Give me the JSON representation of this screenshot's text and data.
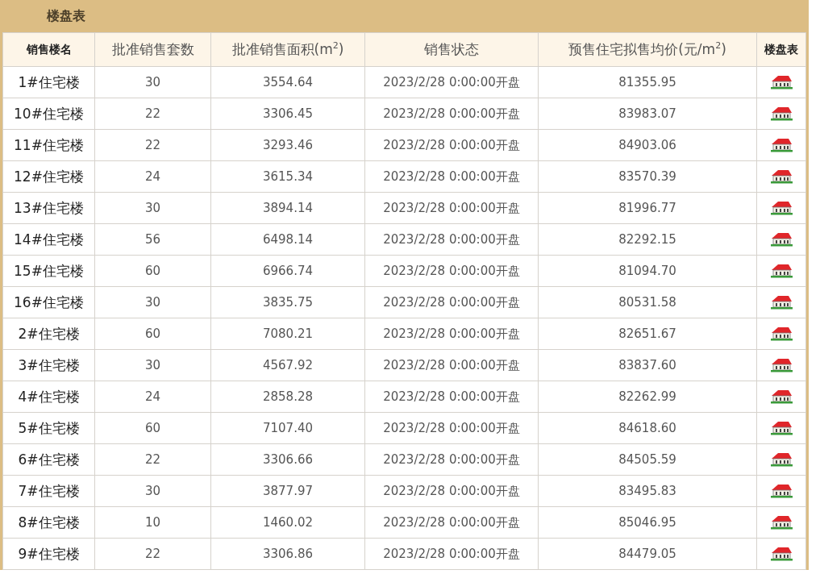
{
  "panel": {
    "title": "楼盘表"
  },
  "table": {
    "columns": [
      {
        "label": "销售楼名",
        "kind": "bold"
      },
      {
        "label": "批准销售套数",
        "kind": "plain"
      },
      {
        "label": "批准销售面积(m$^{2}$)",
        "kind": "plain"
      },
      {
        "label": "销售状态",
        "kind": "plain"
      },
      {
        "label": "预售住宅拟售均价(元/m$^{2}$)",
        "kind": "plain"
      },
      {
        "label": "楼盘表",
        "kind": "bold"
      }
    ],
    "rows": [
      [
        "1#住宅楼",
        "30",
        "3554.64",
        "2023/2/28 0:00:00开盘",
        "81355.95"
      ],
      [
        "10#住宅楼",
        "22",
        "3306.45",
        "2023/2/28 0:00:00开盘",
        "83983.07"
      ],
      [
        "11#住宅楼",
        "22",
        "3293.46",
        "2023/2/28 0:00:00开盘",
        "84903.06"
      ],
      [
        "12#住宅楼",
        "24",
        "3615.34",
        "2023/2/28 0:00:00开盘",
        "83570.39"
      ],
      [
        "13#住宅楼",
        "30",
        "3894.14",
        "2023/2/28 0:00:00开盘",
        "81996.77"
      ],
      [
        "14#住宅楼",
        "56",
        "6498.14",
        "2023/2/28 0:00:00开盘",
        "82292.15"
      ],
      [
        "15#住宅楼",
        "60",
        "6966.74",
        "2023/2/28 0:00:00开盘",
        "81094.70"
      ],
      [
        "16#住宅楼",
        "30",
        "3835.75",
        "2023/2/28 0:00:00开盘",
        "80531.58"
      ],
      [
        "2#住宅楼",
        "60",
        "7080.21",
        "2023/2/28 0:00:00开盘",
        "82651.67"
      ],
      [
        "3#住宅楼",
        "30",
        "4567.92",
        "2023/2/28 0:00:00开盘",
        "83837.60"
      ],
      [
        "4#住宅楼",
        "24",
        "2858.28",
        "2023/2/28 0:00:00开盘",
        "82262.99"
      ],
      [
        "5#住宅楼",
        "60",
        "7107.40",
        "2023/2/28 0:00:00开盘",
        "84618.60"
      ],
      [
        "6#住宅楼",
        "22",
        "3306.66",
        "2023/2/28 0:00:00开盘",
        "84505.59"
      ],
      [
        "7#住宅楼",
        "30",
        "3877.97",
        "2023/2/28 0:00:00开盘",
        "83495.83"
      ],
      [
        "8#住宅楼",
        "10",
        "1460.02",
        "2023/2/28 0:00:00开盘",
        "85046.95"
      ],
      [
        "9#住宅楼",
        "22",
        "3306.86",
        "2023/2/28 0:00:00开盘",
        "84479.05"
      ]
    ]
  }
}
